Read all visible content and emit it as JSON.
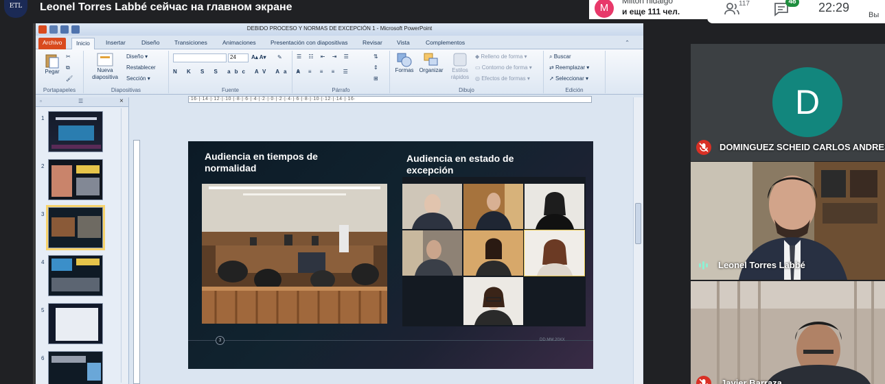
{
  "meet": {
    "logo_text": "ETL",
    "presenting_title": "Leonel Torres Labbé сейчас на главном экране",
    "participant_chip": {
      "avatar_letter": "M",
      "name": "Milton hidalgo",
      "more": "и еще 111 чел."
    },
    "people_count": "117",
    "chat_count": "48",
    "time": "22:29",
    "self_label": "Вы"
  },
  "powerpoint": {
    "window_title": "DEBIDO PROCESO Y NORMAS DE EXCEPCIÓN 1 - Microsoft PowerPoint",
    "tabs": [
      "Archivo",
      "Inicio",
      "Insertar",
      "Diseño",
      "Transiciones",
      "Animaciones",
      "Presentación con diapositivas",
      "Revisar",
      "Vista",
      "Complementos"
    ],
    "active_tab": "Inicio",
    "groups": {
      "portapapeles": {
        "label": "Portapapeles",
        "paste": "Pegar"
      },
      "diapositivas": {
        "label": "Diapositivas",
        "new_slide": "Nueva diapositiva",
        "layout": "Diseño",
        "reset": "Restablecer",
        "section": "Sección"
      },
      "fuente": {
        "label": "Fuente",
        "size": "24"
      },
      "parrafo": {
        "label": "Párrafo"
      },
      "dibujo": {
        "label": "Dibujo",
        "shapes": "Formas",
        "arrange": "Organizar",
        "quick_styles": "Estilos rápidos",
        "fill": "Relleno de forma",
        "outline": "Contorno de forma",
        "effects": "Efectos de formas"
      },
      "edicion": {
        "label": "Edición",
        "find": "Buscar",
        "replace": "Reemplazar",
        "select": "Seleccionar"
      }
    },
    "ruler_text": "·16·|·14·|·12·|·10·|·8·|·6·|·4·|·2·|·0·|·2·|·4·|·6·|·8·|·10·|·12·|·14·|·16·",
    "slide_numbers": [
      "1",
      "2",
      "3",
      "4",
      "5",
      "6"
    ],
    "selected_slide": "3",
    "slide": {
      "left_heading": "Audiencia  en tiempos de normalidad",
      "right_heading": "Audiencia  en estado de excepción",
      "page_number": "3",
      "date_text": "DD.MM.20XX"
    }
  },
  "tiles": [
    {
      "name": "DOMINGUEZ SCHEID CARLOS ANDRES",
      "avatar_letter": "D",
      "muted": true
    },
    {
      "name": "Leonel Torres Labbé",
      "speaking": true
    },
    {
      "name": "Javier Barraza",
      "muted": true
    }
  ],
  "colors": {
    "meet_bg": "#202124",
    "avatar_d": "#12867d",
    "avatar_m": "#e8396a",
    "chat_badge": "#1e8e3e",
    "mic_off": "#d93025",
    "file_tab": "#d94a1e"
  }
}
